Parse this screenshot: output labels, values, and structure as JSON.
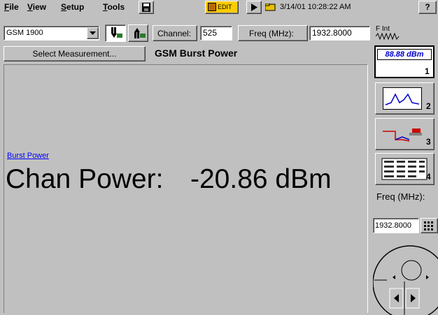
{
  "menu": {
    "file": {
      "hot": "F",
      "rest": "ile"
    },
    "view": {
      "hot": "V",
      "rest": "iew"
    },
    "setup": {
      "hot": "S",
      "rest": "etup"
    },
    "tools": {
      "hot": "T",
      "rest": "ools"
    },
    "help": "?"
  },
  "toolbar": {
    "edit_label": "EDIT",
    "datetime": "3/14/01 10:28:22 AM"
  },
  "controls": {
    "standard": "GSM 1900",
    "channel_label": "Channel:",
    "channel_value": "525",
    "freq_label": "Freq (MHz):",
    "freq_value": "1932.8000",
    "fint_label": "F Int"
  },
  "measure": {
    "select_button": "Select Measurement...",
    "title": "GSM Burst Power"
  },
  "main": {
    "link": "Burst Power",
    "readout_label": "Chan Power:",
    "readout_value": "-20.86 dBm"
  },
  "sidebar": {
    "view1_readout": "88.88 dBm",
    "view1_num": "1",
    "view2_num": "2",
    "view3_num": "3",
    "view4_num": "4",
    "freq_label": "Freq (MHz):",
    "freq_value": "1932.8000"
  }
}
